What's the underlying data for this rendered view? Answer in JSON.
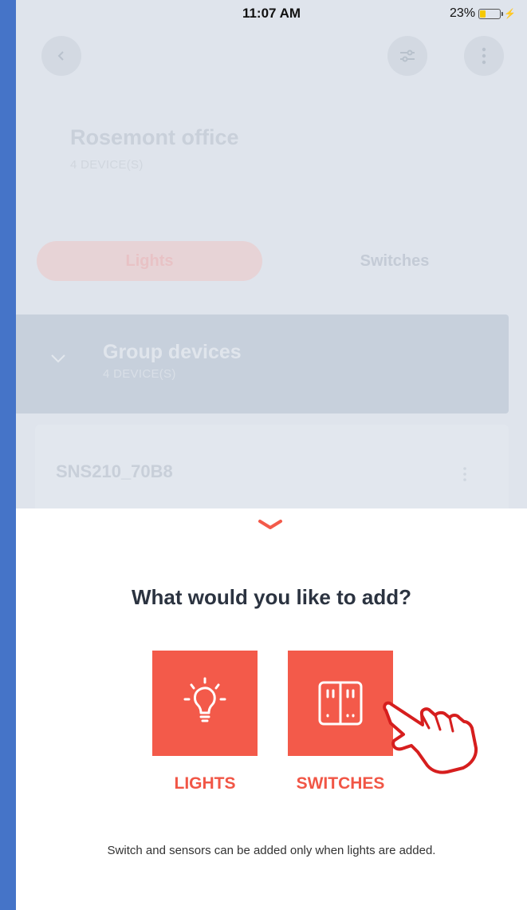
{
  "status_bar": {
    "time": "11:07 AM",
    "battery": "23%"
  },
  "header": {
    "back_icon": "chevron-left-icon",
    "filter_icon": "sliders-icon",
    "more_icon": "more-vertical-icon"
  },
  "location": {
    "name": "Rosemont office",
    "device_count": "4 DEVICE(S)"
  },
  "tabs": [
    {
      "label": "Lights",
      "active": true
    },
    {
      "label": "Switches",
      "active": false
    }
  ],
  "group": {
    "title": "Group devices",
    "device_count": "4 DEVICE(S)"
  },
  "device": {
    "name": "SNS210_70B8"
  },
  "sheet": {
    "question": "What would you like to add?",
    "options": [
      {
        "label": "LIGHTS",
        "icon": "lightbulb-icon"
      },
      {
        "label": "SWITCHES",
        "icon": "switch-icon"
      }
    ],
    "note": "Switch and sensors can be added only when lights are added."
  },
  "colors": {
    "accent": "#f35a4a",
    "accent_text": "#f15646",
    "sheet_bg": "#ffffff",
    "outer_bg": "#4574c8"
  }
}
